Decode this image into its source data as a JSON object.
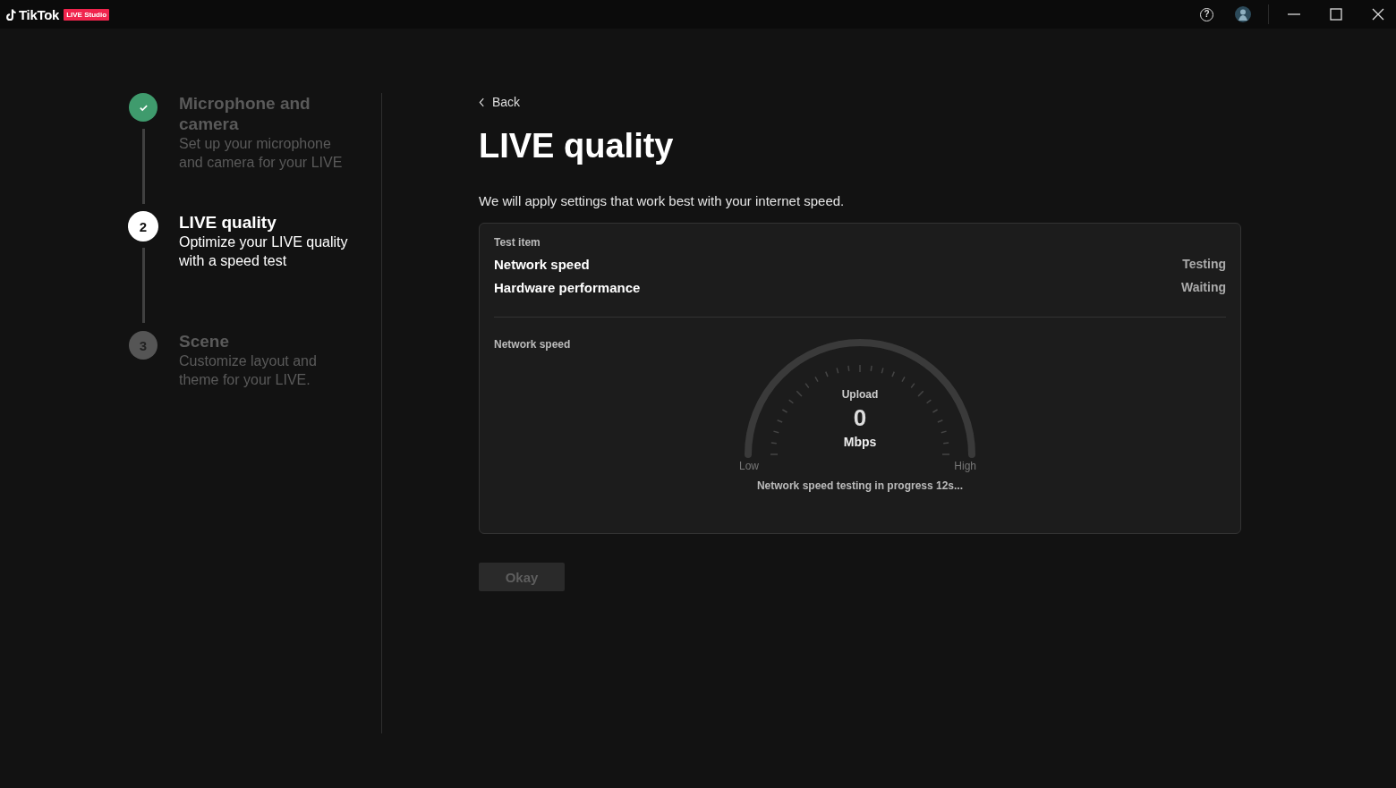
{
  "titlebar": {
    "app_name": "TikTok",
    "badge": "LIVE Studio",
    "help": "?"
  },
  "steps": [
    {
      "kind": "done",
      "title": "Microphone and camera",
      "description": "Set up your microphone and camera for your LIVE",
      "selected": false
    },
    {
      "kind": "current",
      "number": "2",
      "title": "LIVE quality",
      "description": "Optimize your LIVE quality with a speed test",
      "selected": true
    },
    {
      "kind": "pending",
      "number": "3",
      "title": "Scene",
      "description": "Customize layout and theme for your LIVE.",
      "selected": false
    }
  ],
  "back": "Back",
  "title": "LIVE quality",
  "intro": "We will apply settings that work best with your internet speed.",
  "test_panel": {
    "header": "Test item",
    "items": [
      {
        "name": "Network speed",
        "status": "Testing"
      },
      {
        "name": "Hardware performance",
        "status": "Waiting"
      }
    ],
    "speed_label": "Network speed",
    "gauge": {
      "caption": "Upload",
      "value": "0",
      "unit": "Mbps",
      "low": "Low",
      "high": "High"
    },
    "progress": "Network speed testing in progress 12s..."
  },
  "okay_button": {
    "label": "Okay",
    "disabled": true
  }
}
